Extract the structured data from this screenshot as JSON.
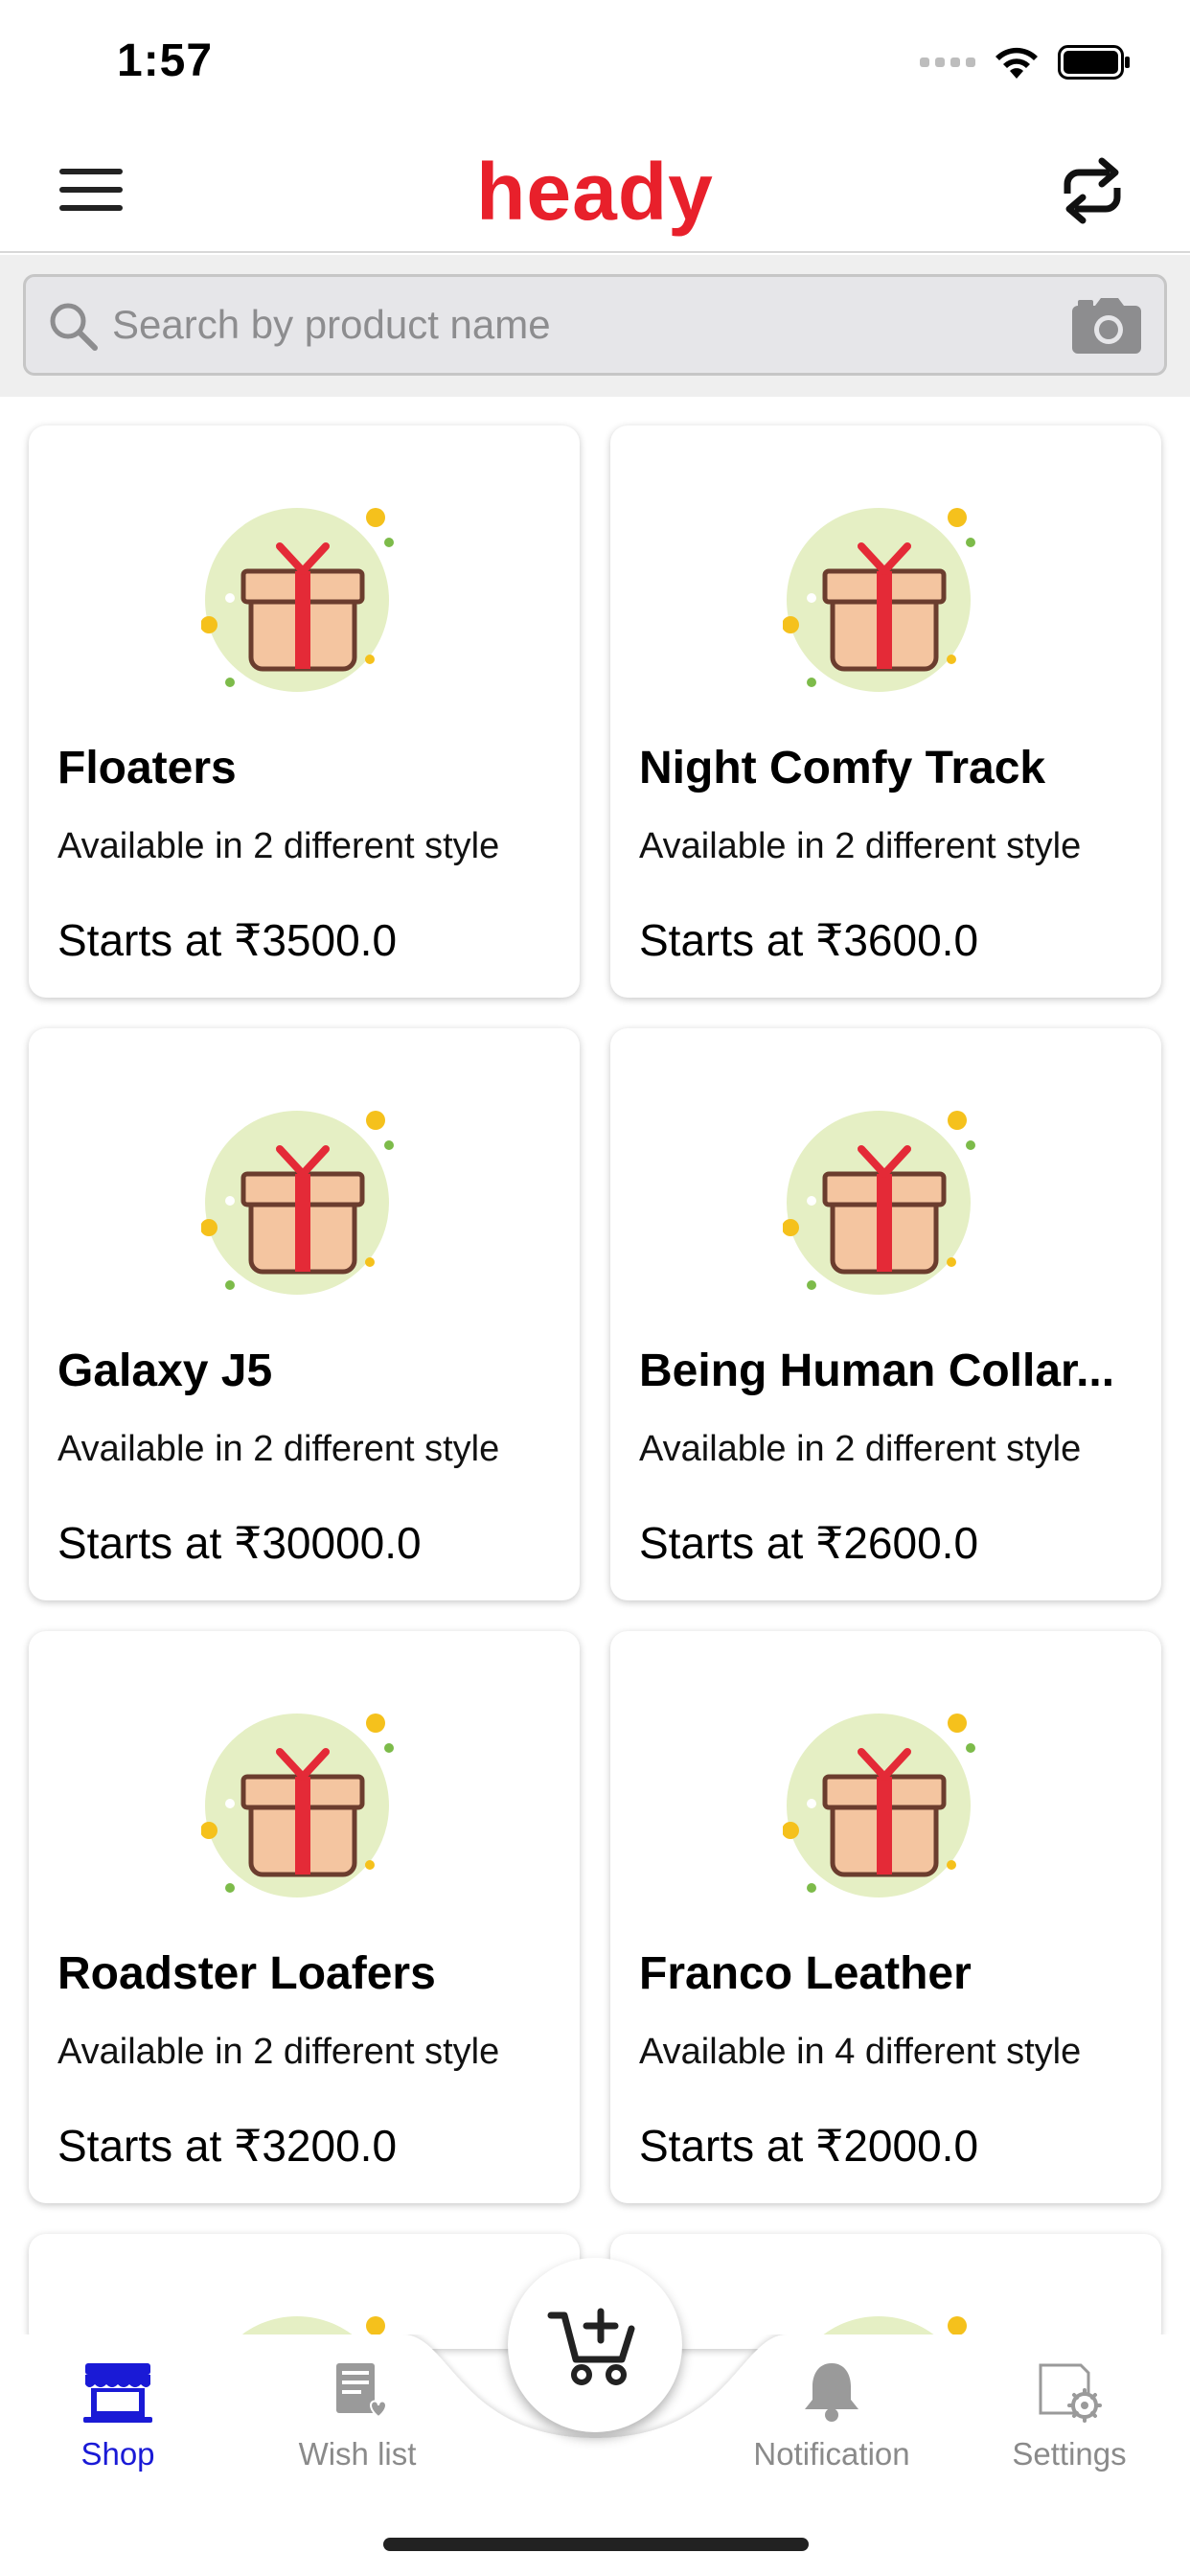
{
  "status_bar": {
    "time": "1:57"
  },
  "header": {
    "title": "heady"
  },
  "search": {
    "placeholder": "Search by product name"
  },
  "products": [
    {
      "name": "Floaters",
      "availability": "Available in 2 different style",
      "price": "Starts at ₹3500.0"
    },
    {
      "name": "Night Comfy Track",
      "availability": "Available in 2 different style",
      "price": "Starts at ₹3600.0"
    },
    {
      "name": "Galaxy J5",
      "availability": "Available in 2 different style",
      "price": "Starts at ₹30000.0"
    },
    {
      "name": "Being Human Collar...",
      "availability": "Available in 2 different style",
      "price": "Starts at ₹2600.0"
    },
    {
      "name": "Roadster Loafers",
      "availability": "Available in 2 different style",
      "price": "Starts at ₹3200.0"
    },
    {
      "name": "Franco Leather",
      "availability": "Available in 4 different style",
      "price": "Starts at ₹2000.0"
    }
  ],
  "tabs": [
    {
      "label": "Shop",
      "icon": "shop-icon",
      "active": true
    },
    {
      "label": "Wish list",
      "icon": "wishlist-icon",
      "active": false
    },
    {
      "label": "Notification",
      "icon": "bell-icon",
      "active": false
    },
    {
      "label": "Settings",
      "icon": "settings-icon",
      "active": false
    }
  ],
  "colors": {
    "brand": "#e8202b",
    "active_tab": "#1a1ad6",
    "inactive_tab": "#8a8a8a"
  }
}
